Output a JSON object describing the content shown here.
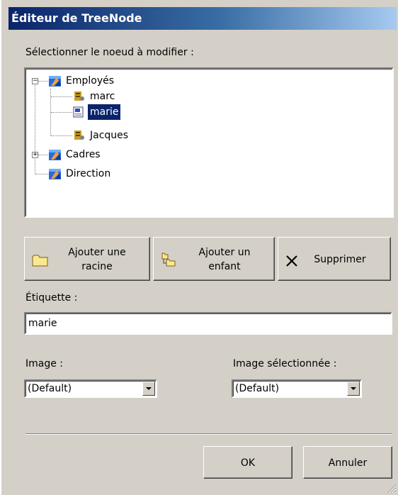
{
  "window": {
    "title": "Éditeur de TreeNode"
  },
  "tree": {
    "label": "Sélectionner le noeud à modifier :",
    "nodes": [
      {
        "label": "Employés",
        "icon": "group-icon",
        "expanded": true
      },
      {
        "label": "marc",
        "icon": "user-icon"
      },
      {
        "label": "marie",
        "icon": "document-icon",
        "selected": true
      },
      {
        "label": "Jacques",
        "icon": "user-icon"
      },
      {
        "label": "Cadres",
        "icon": "group-icon",
        "expanded": false
      },
      {
        "label": "Direction",
        "icon": "group-icon"
      }
    ]
  },
  "buttons": {
    "add_root": "Ajouter une racine",
    "add_root_line1": "Ajouter une",
    "add_root_line2": "racine",
    "add_child": "Ajouter un enfant",
    "add_child_line1": "Ajouter un",
    "add_child_line2": "enfant",
    "delete": "Supprimer",
    "ok": "OK",
    "cancel": "Annuler"
  },
  "label_field": {
    "label": "Étiquette :",
    "value": "marie"
  },
  "image": {
    "label": "Image :",
    "value": "(Default)"
  },
  "selected_image": {
    "label": "Image sélectionnée :",
    "value": "(Default)"
  },
  "colors": {
    "title_start": "#0a246a",
    "title_end": "#a6caf0",
    "face": "#d4d0c8",
    "selection": "#0a246a"
  }
}
